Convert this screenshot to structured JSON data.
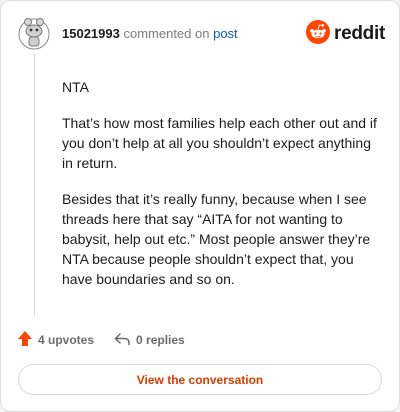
{
  "header": {
    "username": "15021993",
    "action_text": "commented on",
    "post_link": "post",
    "brand_name": "reddit",
    "avatar_icon": "snoo-avatar-icon",
    "brand_icon": "reddit-logo-icon"
  },
  "comment": {
    "paragraphs": [
      "NTA",
      "That’s how most families help each other out and if you don’t help at all you shouldn’t expect anything in return.",
      "Besides that it’s really funny, because when I see threads here that say “AITA for not wanting to babysit, help out etc.” Most people answer they’re NTA because people shouldn’t expect that, you have boundaries and so on."
    ]
  },
  "actions": {
    "upvotes": "4 upvotes",
    "replies": "0 replies",
    "upvote_icon": "upvote-arrow-icon",
    "reply_icon": "reply-arrow-icon"
  },
  "cta": {
    "label": "View the conversation"
  },
  "colors": {
    "brand_orange": "#ff4500",
    "link_blue": "#0a5bb5",
    "cta_text": "#d93a00"
  }
}
